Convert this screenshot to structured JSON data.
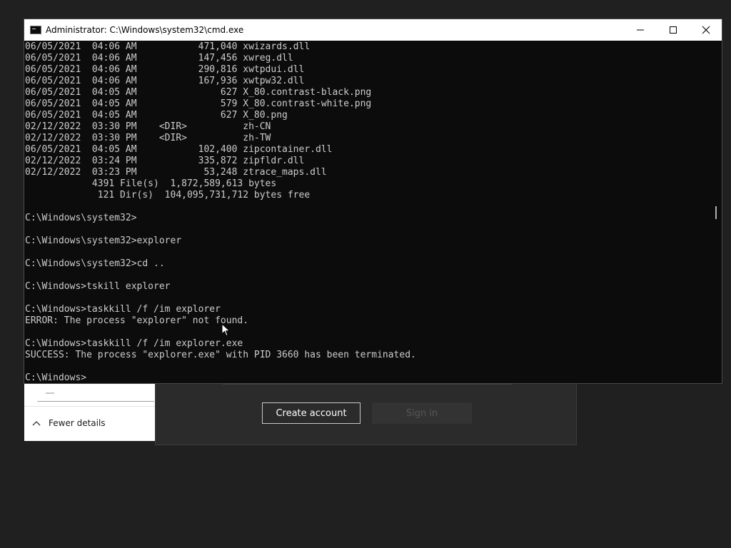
{
  "background_windows": {
    "taskmgr": {
      "fewer_details_label": "Fewer details",
      "chevron_icon": "chevron-up-icon"
    },
    "account_dialog": {
      "create_account_label": "Create account",
      "sign_in_label": "Sign in"
    }
  },
  "cmd": {
    "title": "Administrator: C:\\Windows\\system32\\cmd.exe",
    "icon": "cmd-icon",
    "controls": {
      "minimize": "minimize-icon",
      "maximize": "maximize-icon",
      "close": "close-icon"
    },
    "lines": [
      "06/05/2021  04:06 AM           471,040 xwizards.dll",
      "06/05/2021  04:06 AM           147,456 xwreg.dll",
      "06/05/2021  04:06 AM           290,816 xwtpdui.dll",
      "06/05/2021  04:06 AM           167,936 xwtpw32.dll",
      "06/05/2021  04:05 AM               627 X_80.contrast-black.png",
      "06/05/2021  04:05 AM               579 X_80.contrast-white.png",
      "06/05/2021  04:05 AM               627 X_80.png",
      "02/12/2022  03:30 PM    <DIR>          zh-CN",
      "02/12/2022  03:30 PM    <DIR>          zh-TW",
      "06/05/2021  04:05 AM           102,400 zipcontainer.dll",
      "02/12/2022  03:24 PM           335,872 zipfldr.dll",
      "02/12/2022  03:23 PM            53,248 ztrace_maps.dll",
      "            4391 File(s)  1,872,589,613 bytes",
      "             121 Dir(s)  104,095,731,712 bytes free",
      "",
      "C:\\Windows\\system32>",
      "",
      "C:\\Windows\\system32>explorer",
      "",
      "C:\\Windows\\system32>cd ..",
      "",
      "C:\\Windows>tskill explorer",
      "",
      "C:\\Windows>taskkill /f /im explorer",
      "ERROR: The process \"explorer\" not found.",
      "",
      "C:\\Windows>taskkill /f /im explorer.exe",
      "SUCCESS: The process \"explorer.exe\" with PID 3660 has been terminated.",
      "",
      "C:\\Windows>"
    ]
  },
  "colors": {
    "console_bg": "#0c0c0c",
    "console_text": "#cccccc",
    "desktop_bg": "#202020"
  }
}
